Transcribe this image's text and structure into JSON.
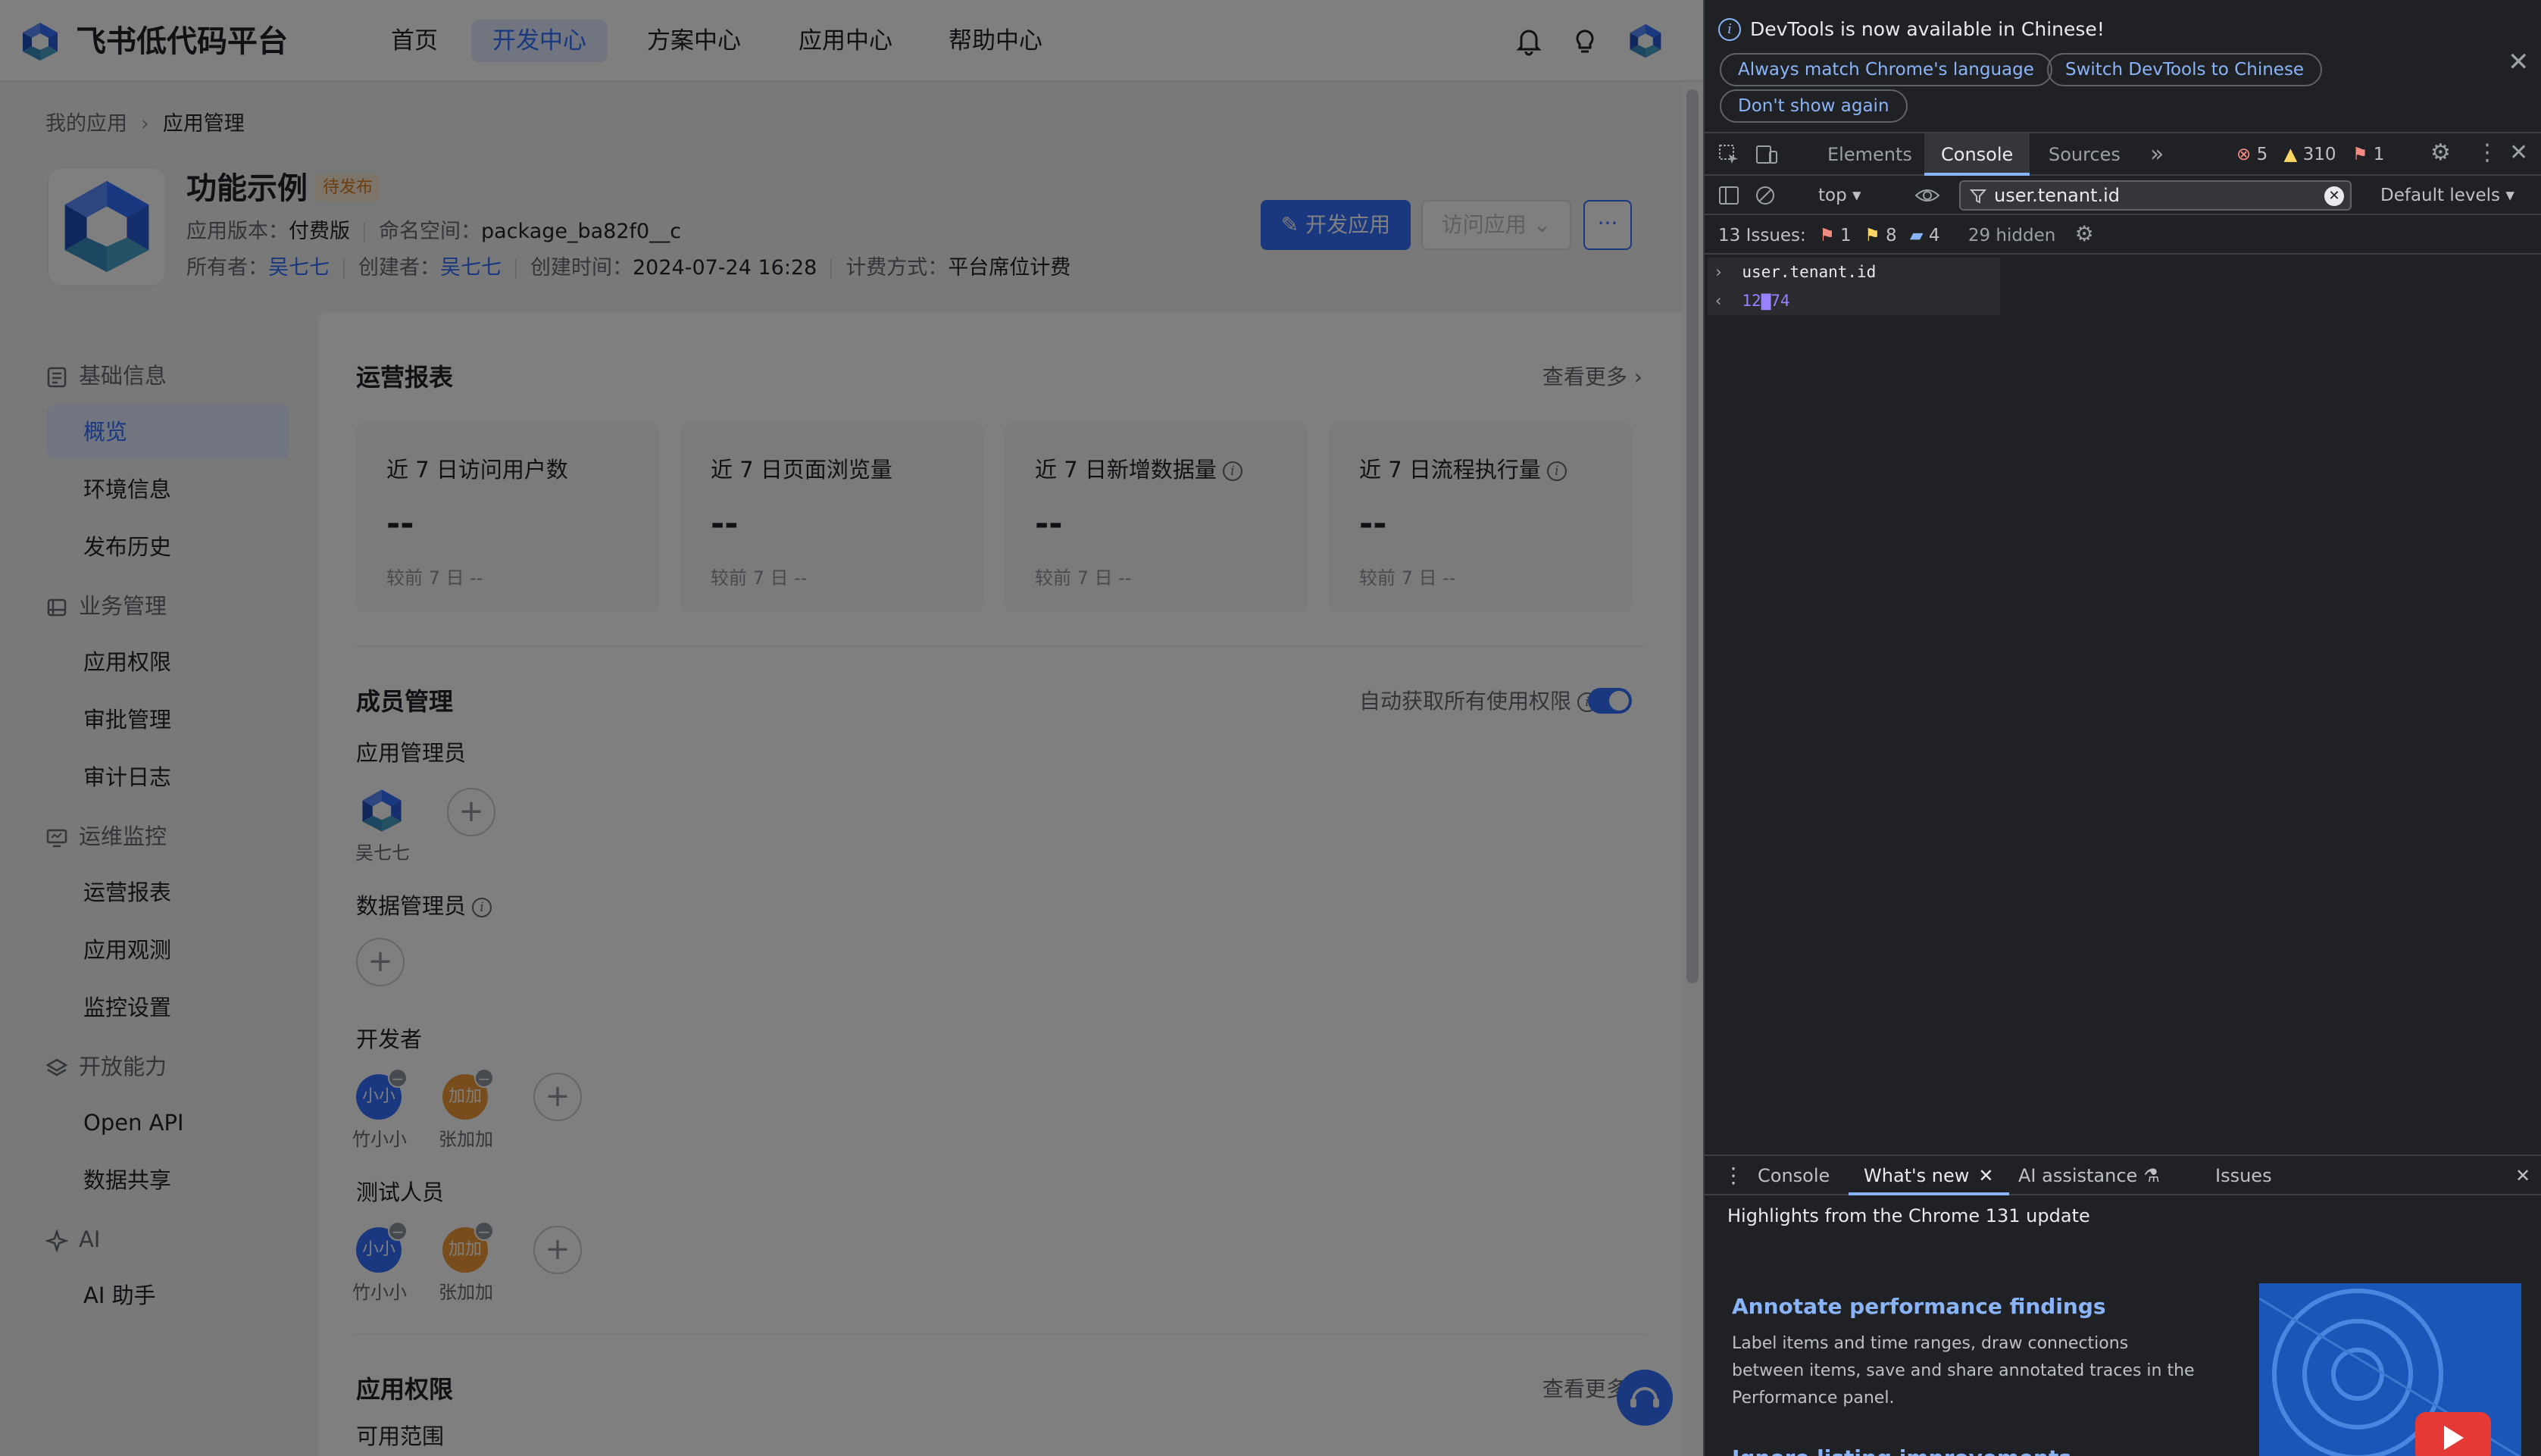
{
  "app": {
    "brand": "飞书低代码平台",
    "nav": [
      "首页",
      "开发中心",
      "方案中心",
      "应用中心",
      "帮助中心"
    ],
    "nav_active": 1,
    "breadcrumb": [
      "我的应用",
      "应用管理"
    ],
    "title": "功能示例",
    "status": "待发布",
    "meta1": {
      "version_label": "应用版本：",
      "version": "付费版",
      "ns_label": "命名空间：",
      "ns": "package_ba82f0__c"
    },
    "meta2": {
      "owner_label": "所有者：",
      "owner": "吴七七",
      "creator_label": "创建者：",
      "creator": "吴七七",
      "created_label": "创建时间：",
      "created": "2024-07-24 16:28",
      "billing_label": "计费方式：",
      "billing": "平台席位计费"
    },
    "buttons": {
      "develop": "开发应用",
      "visit": "访问应用",
      "more": "···"
    },
    "sidebar": [
      {
        "group": "基础信息",
        "items": [
          "概览",
          "环境信息",
          "发布历史"
        ]
      },
      {
        "group": "业务管理",
        "items": [
          "应用权限",
          "审批管理",
          "审计日志"
        ]
      },
      {
        "group": "运维监控",
        "items": [
          "运营报表",
          "应用观测",
          "监控设置"
        ]
      },
      {
        "group": "开放能力",
        "items": [
          "Open API",
          "数据共享"
        ]
      },
      {
        "group": "AI",
        "items": [
          "AI 助手"
        ]
      }
    ],
    "report": {
      "title": "运营报表",
      "more": "查看更多",
      "cards": [
        {
          "title": "近 7 日访问用户数",
          "value": "--",
          "compare": "较前 7 日  --",
          "info": false
        },
        {
          "title": "近 7 日页面浏览量",
          "value": "--",
          "compare": "较前 7 日  --",
          "info": false
        },
        {
          "title": "近 7 日新增数据量",
          "value": "--",
          "compare": "较前 7 日  --",
          "info": true
        },
        {
          "title": "近 7 日流程执行量",
          "value": "--",
          "compare": "较前 7 日  --",
          "info": true
        }
      ]
    },
    "members": {
      "title": "成员管理",
      "auto_perm": "自动获取所有使用权限",
      "auto_perm_on": true,
      "app_admin": "应用管理员",
      "app_admin_name": "吴七七",
      "data_admin": "数据管理员",
      "developers": "开发者",
      "testers": "测试人员",
      "people": [
        {
          "short": "小小",
          "name": "竹小小",
          "color": "#3370ff"
        },
        {
          "short": "加加",
          "name": "张加加",
          "color": "#f09a37"
        }
      ]
    },
    "perm": {
      "title": "应用权限",
      "more": "查看更多",
      "scope": "可用范围"
    }
  },
  "devtools": {
    "banner": "DevTools is now available in Chinese!",
    "pills": [
      "Always match Chrome's language",
      "Switch DevTools to Chinese",
      "Don't show again"
    ],
    "tabs": [
      "Elements",
      "Console",
      "Sources"
    ],
    "active_tab": 1,
    "counts": {
      "errors": "5",
      "warnings": "310",
      "issues": "1"
    },
    "context": "top",
    "filter": "user.tenant.id",
    "levels": "Default levels",
    "issues_label": "13 Issues:",
    "issue_counts": [
      "1",
      "8",
      "4"
    ],
    "hidden": "29 hidden",
    "console_input": "user.tenant.id",
    "console_output": "12▇74",
    "drawer_tabs": [
      "Console",
      "What's new",
      "AI assistance",
      "Issues"
    ],
    "drawer_active": 1,
    "highlights": "Highlights from the Chrome 131 update",
    "feature1": "Annotate performance findings",
    "feature1_text": "Label items and time ranges, draw connections between items, save and share annotated traces in the Performance panel.",
    "feature2": "Ignore listing improvements"
  }
}
